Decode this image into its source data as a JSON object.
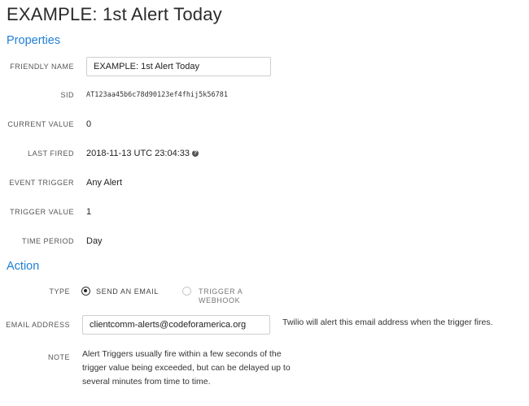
{
  "page": {
    "title": "EXAMPLE: 1st Alert Today"
  },
  "properties": {
    "heading": "Properties",
    "friendly_name": {
      "label": "FRIENDLY NAME",
      "value": "EXAMPLE: 1st Alert Today"
    },
    "sid": {
      "label": "SID",
      "value": "AT123aa45b6c78d90123ef4fhij5k56781"
    },
    "current_value": {
      "label": "CURRENT VALUE",
      "value": "0"
    },
    "last_fired": {
      "label": "LAST FIRED",
      "value": "2018-11-13 UTC 23:04:33",
      "icon": "help-icon"
    },
    "event_trigger": {
      "label": "EVENT TRIGGER",
      "value": "Any Alert"
    },
    "trigger_value": {
      "label": "TRIGGER VALUE",
      "value": "1"
    },
    "time_period": {
      "label": "TIME PERIOD",
      "value": "Day"
    }
  },
  "action": {
    "heading": "Action",
    "type": {
      "label": "TYPE",
      "options": [
        {
          "label": "SEND AN EMAIL",
          "selected": true
        },
        {
          "label": "TRIGGER A WEBHOOK",
          "label_line1": "TRIGGER A",
          "label_line2": "WEBHOOK",
          "selected": false
        }
      ]
    },
    "email_address": {
      "label": "EMAIL ADDRESS",
      "value": "clientcomm-alerts@codeforamerica.org",
      "hint": "Twilio will alert this email address when the trigger fires."
    },
    "note": {
      "label": "NOTE",
      "text": "Alert Triggers usually fire within a few seconds of the trigger value being exceeded, but can be delayed up to several minutes from time to time."
    }
  },
  "colors": {
    "accent": "#1f7fd6",
    "text": "#222222",
    "border": "#cfcfcf"
  }
}
